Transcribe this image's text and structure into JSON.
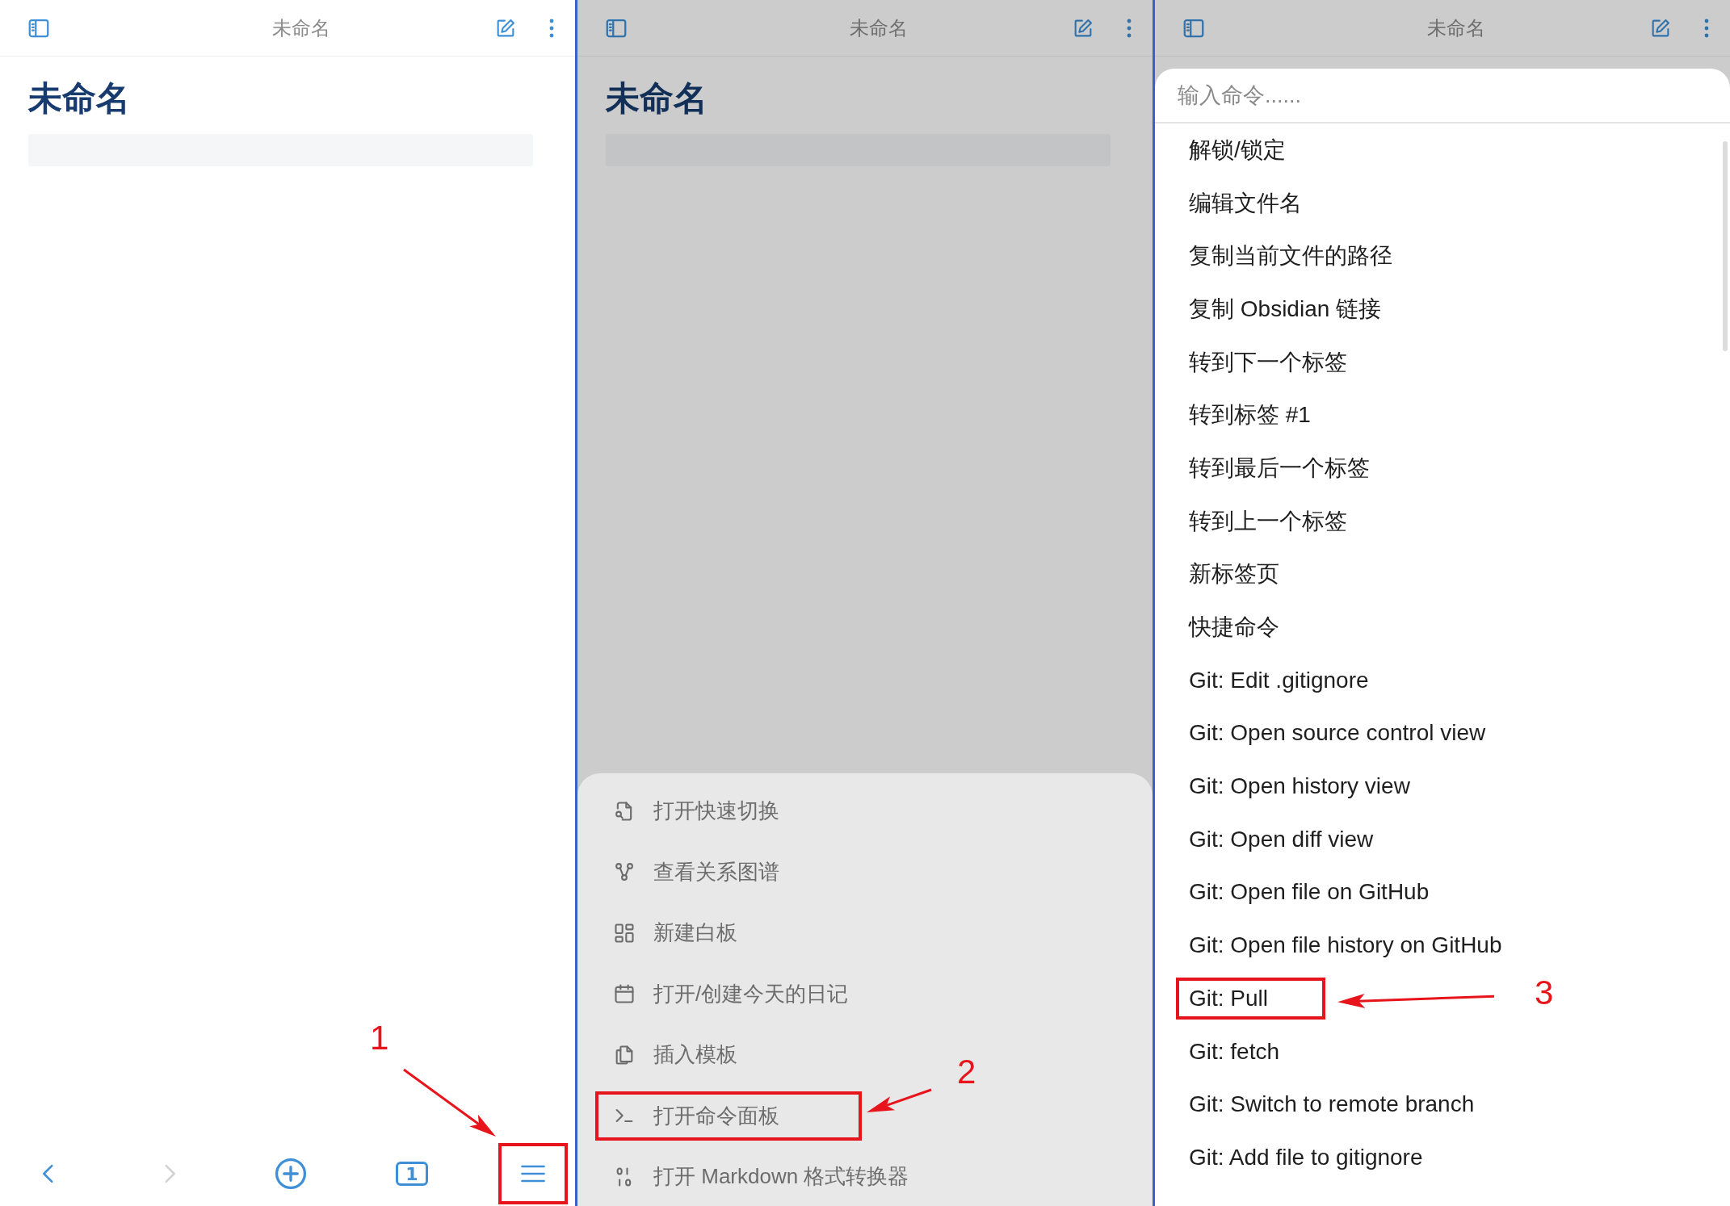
{
  "panels": [
    {
      "kind": "editor",
      "top_bar": {
        "title": "未命名"
      },
      "note": {
        "title": "未命名"
      },
      "bottom_nav": [
        {
          "kind": "back",
          "disabled": false,
          "highlighted": false
        },
        {
          "kind": "forward",
          "disabled": true,
          "highlighted": false
        },
        {
          "kind": "new",
          "disabled": false,
          "highlighted": false
        },
        {
          "kind": "tabs",
          "label": "1",
          "disabled": false,
          "highlighted": false
        },
        {
          "kind": "menu",
          "disabled": false,
          "highlighted": true
        }
      ],
      "annotation": {
        "label": "1"
      }
    },
    {
      "kind": "menu",
      "dimmed": true,
      "top_bar": {
        "title": "未命名"
      },
      "note": {
        "title": "未命名"
      },
      "menu_items": [
        {
          "kind": "switcher",
          "label": "打开快速切换",
          "highlighted": false
        },
        {
          "kind": "graph",
          "label": "查看关系图谱",
          "highlighted": false
        },
        {
          "kind": "canvas",
          "label": "新建白板",
          "highlighted": false
        },
        {
          "kind": "calendar",
          "label": "打开/创建今天的日记",
          "highlighted": false
        },
        {
          "kind": "template",
          "label": "插入模板",
          "highlighted": false
        },
        {
          "kind": "terminal",
          "label": "打开命令面板",
          "highlighted": true
        },
        {
          "kind": "binary",
          "label": "打开 Markdown 格式转换器",
          "highlighted": false
        }
      ],
      "annotation": {
        "label": "2"
      }
    },
    {
      "kind": "palette",
      "dimmed": true,
      "top_bar": {
        "title": "未命名"
      },
      "palette": {
        "placeholder": "输入命令......",
        "items": [
          {
            "label": "解锁/锁定",
            "highlighted": false
          },
          {
            "label": "编辑文件名",
            "highlighted": false
          },
          {
            "label": "复制当前文件的路径",
            "highlighted": false
          },
          {
            "label": "复制 Obsidian 链接",
            "highlighted": false
          },
          {
            "label": "转到下一个标签",
            "highlighted": false
          },
          {
            "label": "转到标签 #1",
            "highlighted": false
          },
          {
            "label": "转到最后一个标签",
            "highlighted": false
          },
          {
            "label": "转到上一个标签",
            "highlighted": false
          },
          {
            "label": "新标签页",
            "highlighted": false
          },
          {
            "label": "快捷命令",
            "highlighted": false
          },
          {
            "label": "Git: Edit .gitignore",
            "highlighted": false
          },
          {
            "label": "Git: Open source control view",
            "highlighted": false
          },
          {
            "label": "Git: Open history view",
            "highlighted": false
          },
          {
            "label": "Git: Open diff view",
            "highlighted": false
          },
          {
            "label": "Git: Open file on GitHub",
            "highlighted": false
          },
          {
            "label": "Git: Open file history on GitHub",
            "highlighted": false
          },
          {
            "label": "Git: Pull",
            "highlighted": true
          },
          {
            "label": "Git: fetch",
            "highlighted": false
          },
          {
            "label": "Git: Switch to remote branch",
            "highlighted": false
          },
          {
            "label": "Git: Add file to gitignore",
            "highlighted": false
          }
        ]
      },
      "annotation": {
        "label": "3"
      }
    }
  ]
}
